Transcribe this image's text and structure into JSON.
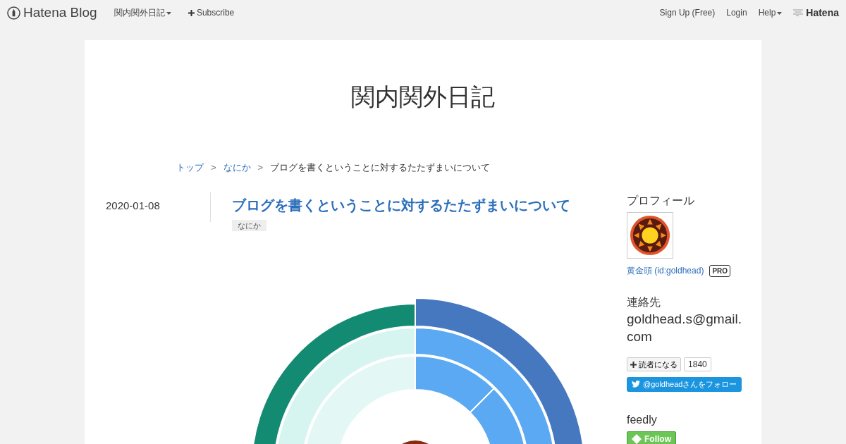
{
  "topbar": {
    "brand": "Hatena Blog",
    "blog_menu": "関内関外日記",
    "subscribe": "Subscribe",
    "links": [
      {
        "label": "Sign Up (Free)",
        "dropdown": false
      },
      {
        "label": "Login",
        "dropdown": false
      },
      {
        "label": "Help",
        "dropdown": true
      }
    ],
    "hatena": "Hatena"
  },
  "blog_title": "関内関外日記",
  "breadcrumb": [
    {
      "label": "トップ",
      "link": true
    },
    {
      "label": "なにか",
      "link": true
    },
    {
      "label": "ブログを書くということに対するたたずまいについて",
      "link": false
    }
  ],
  "breadcrumb_separator": ">",
  "entry": {
    "date": "2020-01-08",
    "title": "ブログを書くということに対するたたずまいについて",
    "category": "なにか"
  },
  "sidebar": {
    "profile_heading": "プロフィール",
    "user": "黄金頭 (id:goldhead)",
    "badge": "PRO",
    "contact_heading": "連絡先",
    "contact": "goldhead.s@gmail.com",
    "reader_button": "読者になる",
    "reader_count": "1840",
    "twitter_button": "@goldheadさんをフォロー",
    "feedly_heading": "feedly",
    "feedly_button": "Follow"
  }
}
